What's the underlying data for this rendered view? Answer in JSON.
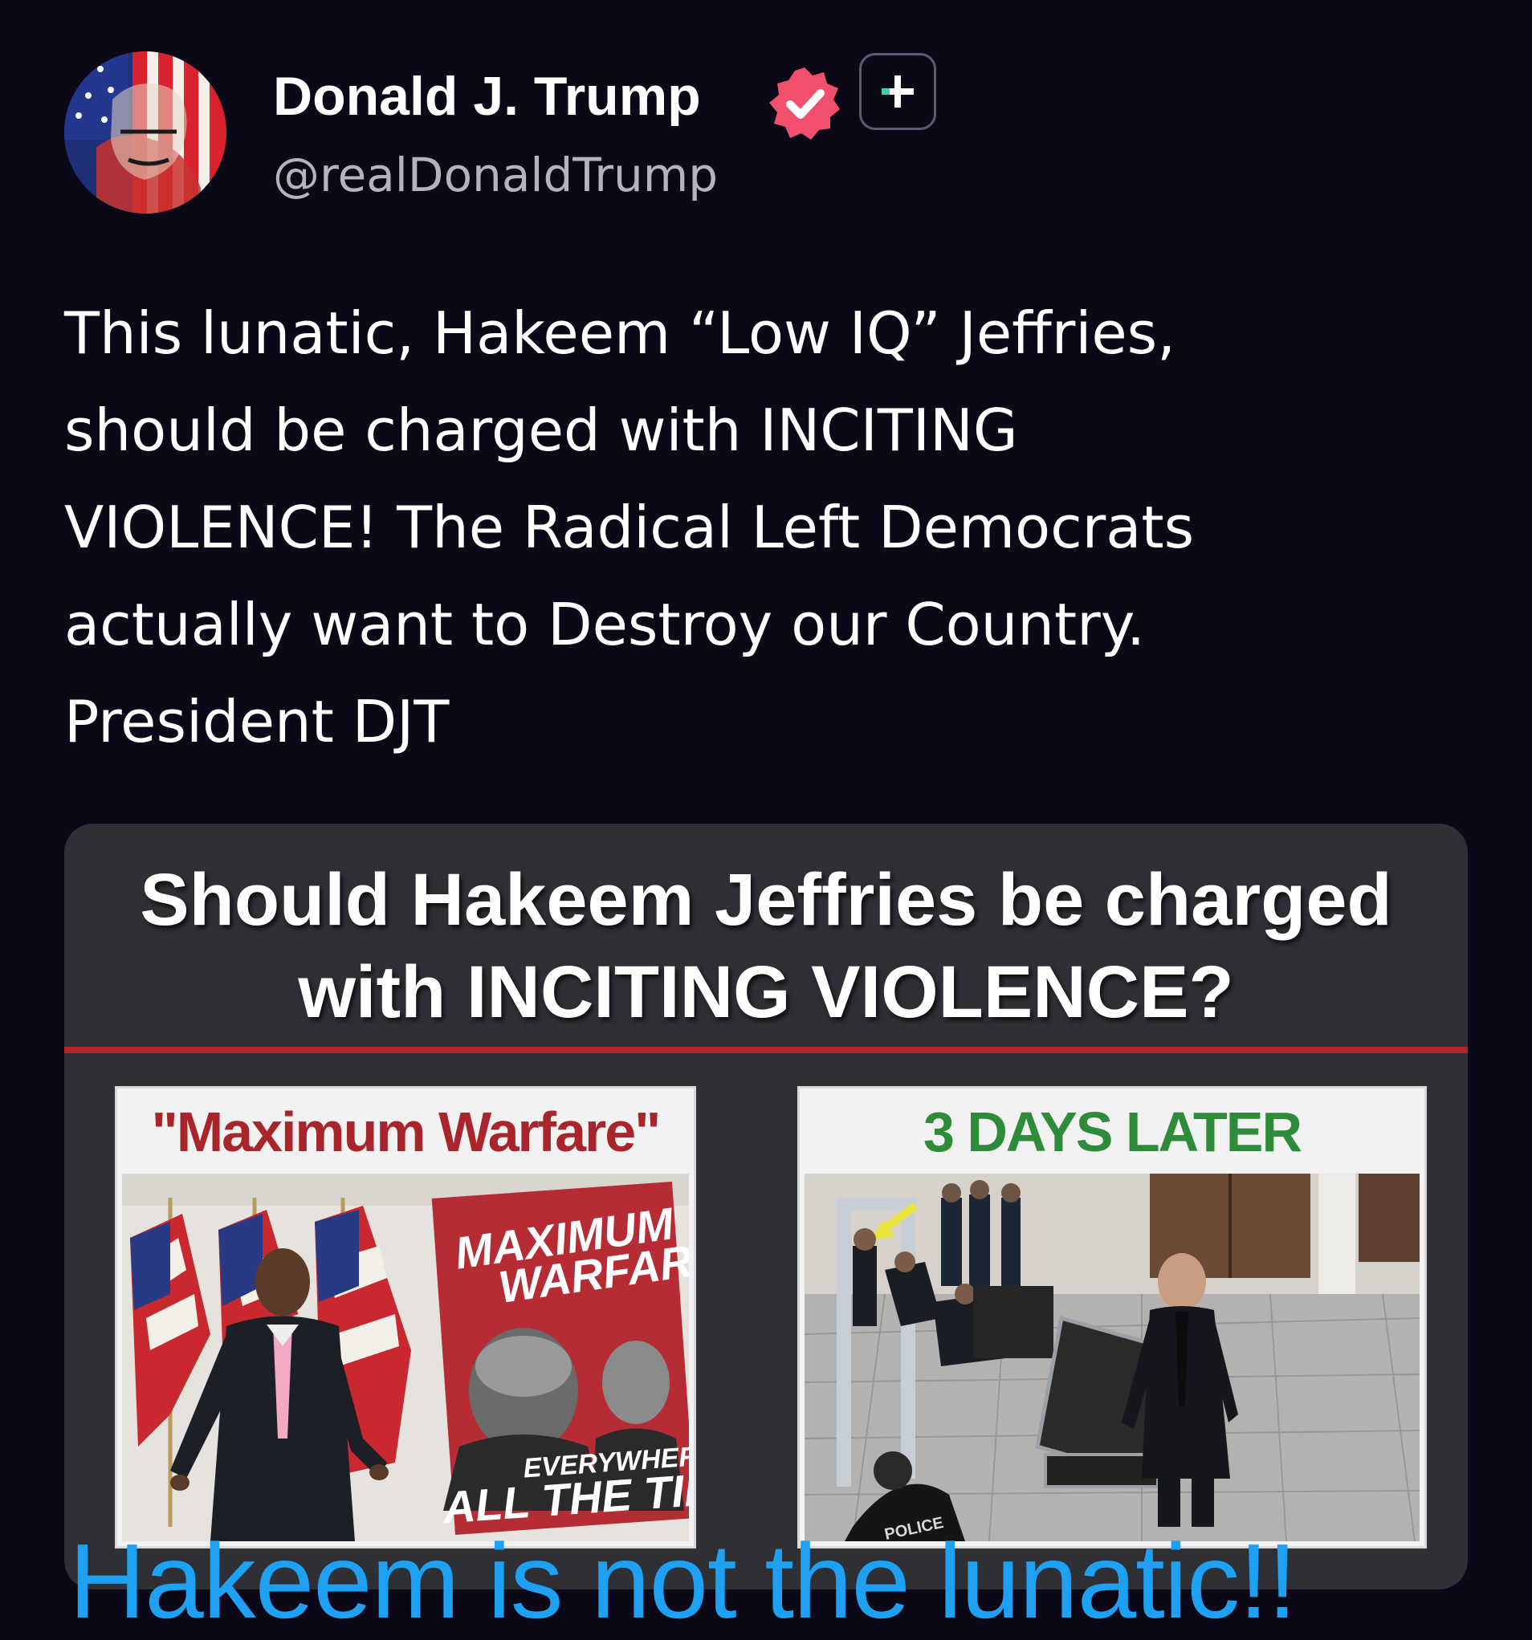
{
  "profile": {
    "display_name": "Donald J. Trump",
    "handle": "@realDonaldTrump",
    "avatar_icon": "avatar-portrait",
    "verified_icon": "verified-badge-icon",
    "follow_icon": "plus-icon",
    "verified_color": "#f0506e"
  },
  "post": {
    "lines": [
      "This lunatic, Hakeem “Low IQ” Jeffries,",
      "should be charged with INCITING",
      "VIOLENCE! The Radical Left Democrats",
      "actually want to Destroy our Country.",
      "President DJT"
    ]
  },
  "media": {
    "headline_lines": [
      "Should Hakeem Jeffries be charged",
      "with INCITING VIOLENCE?"
    ],
    "left_panel": {
      "caption": "\"Maximum Warfare\"",
      "caption_color": "#a8252b",
      "sign_lines": [
        "MAXIMUM",
        "WARFARE"
      ],
      "sign_footer_lines": [
        "EVERYWHERE.",
        "ALL THE TIME."
      ]
    },
    "right_panel": {
      "caption": "3 DAYS LATER",
      "caption_color": "#2e8b3a",
      "police_text": "POLICE"
    },
    "divider_color": "#b5232b"
  },
  "overlay": {
    "caption": "Hakeem is not the lunatic!!",
    "color": "#1ea1f2"
  }
}
